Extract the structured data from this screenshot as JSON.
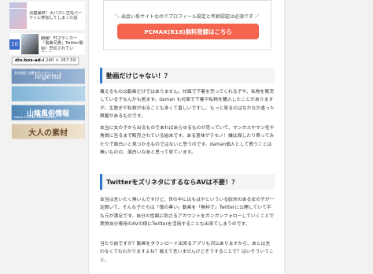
{
  "sidebar": {
    "items": [
      {
        "rank": "",
        "text": ""
      },
      {
        "rank": "",
        "text": "清楚最終！大バズレ生SJパーティに参加してしまった話"
      },
      {
        "rank": "10",
        "text": "朗報！FC2ランカー『黒曲兄貴』Twitter開始！早凹されている！？"
      }
    ],
    "tooltip": {
      "selector": "div.box-ad-i",
      "size": "240 × 267.59"
    },
    "banners": [
      {
        "text": "legend",
        "sub": "女性限定 自撮りギャラリー"
      },
      {
        "text": "",
        "sub": ""
      },
      {
        "text": "山陰風俗情報",
        "sub": "Sanin Fuzoku Information"
      },
      {
        "text": "大人の素材",
        "sub": ""
      }
    ]
  },
  "ad": {
    "note": "＼ 出会い系サイトなのでプロフィール設定と年齢認証は必須です ／",
    "button_label": "PCMAX(R18)無料登録はこちら"
  },
  "article": {
    "section1": {
      "heading": "動画だけじゃない！？",
      "p1": "裏えるものは動画だけではありません。対面で下着を売ってくれる子や、私物を販売している子なんかも居ます。daman も対面で下着や私物を購入したことがありますが、生脱ぎや私物が出ることも多くて喜しいですし、もっと見るのはなかなか違った興奮があるものです。",
      "p2": "本当に女の子から出るものであればあらゆるものが売っていて、マンカスやマン毛や角質に至るまで販売されている始末です。ある意味ゲテモノ！嫌は探したり買ってみたりで面白いと見つかるものではないと思うのです。daman個人として買うことは無いものの、面白いなあと思って見ています。"
    },
    "section2": {
      "heading": "TwitterをズリネタにするならAVは不要！？",
      "p1": "本当は言いたく無いんですけど、世の中にはもはやといういる欧米のある女の子が一定数いて、そんな子たちは「僕の黒い」動画を「無料で」Twitterに公開していて手も元が満足です。自分の性癖に刺さるアカウントをガンガンフォローしていくことで実質自分専用のAVの様にTwitterを活用することも出来てしまうのです。",
      "p2": "当たり前ですが？動画をダウンロード出来るアプリも沢山ありますから、あとは言わなくてもわかりますよね？敢えて言いませんけどそうすることで？はいそういうこと。"
    }
  }
}
